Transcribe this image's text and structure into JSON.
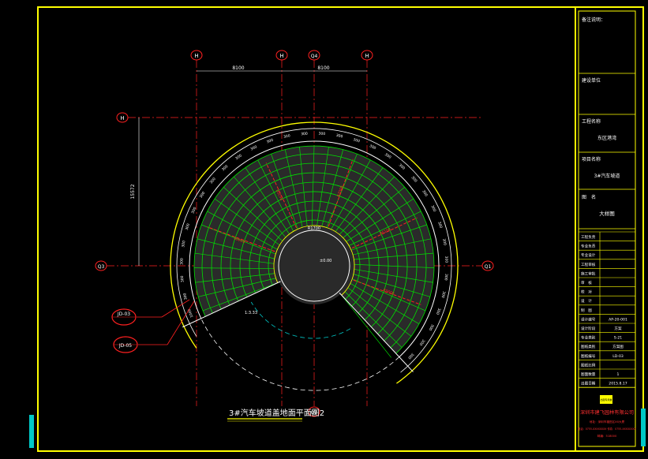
{
  "colors": {
    "frame": "#ffff00",
    "grid_line": "#ff2020",
    "tile": "#00e000",
    "dim": "#ffffff",
    "callout": "#ff2020",
    "cyan": "#00c8c8",
    "company": "#ff3030"
  },
  "drawing": {
    "title": "3#汽车坡道盖地面平面图2",
    "axis_top": [
      "H",
      "H",
      "Q4",
      "H"
    ],
    "axis_left": "H",
    "axis_q3": "Q3",
    "axis_q1": "Q1",
    "axis_q2": "Q2",
    "dim_top_left": "8100",
    "dim_top_right": "8100",
    "dim_vertical": "15572",
    "center_label": "R1700",
    "center_elev": "±0.00",
    "callout_1": "JD-03",
    "callout_2": "JD-05",
    "slope_label": "1:3.33",
    "ring_dims": [
      "1000",
      "300",
      "300",
      "300",
      "300",
      "300",
      "300",
      "300",
      "300",
      "300",
      "300",
      "300",
      "300",
      "300",
      "300",
      "300",
      "300",
      "300",
      "300",
      "300",
      "300",
      "300",
      "300",
      "300",
      "300",
      "300",
      "300",
      "300",
      "300",
      "300",
      "300",
      "300",
      "300"
    ],
    "radial_labels": [
      "R3400",
      "R6300",
      "R7000",
      "R6100",
      "R5600"
    ]
  },
  "title_block": {
    "header": "备注说明：",
    "client_label": "建设单位",
    "project_label": "工程名称",
    "project_value": "东区港湾",
    "item_label": "项目名称",
    "item_value": "3#汽车坡道",
    "drawing_name_label": "图　名",
    "drawing_name_value": "大样图",
    "rows": [
      {
        "label": "工程负责",
        "value": ""
      },
      {
        "label": "专业负责",
        "value": ""
      },
      {
        "label": "专业设计",
        "value": ""
      },
      {
        "label": "工程审核",
        "value": ""
      },
      {
        "label": "施工审批",
        "value": ""
      },
      {
        "label": "审　核",
        "value": ""
      },
      {
        "label": "校　对",
        "value": ""
      },
      {
        "label": "设　计",
        "value": ""
      },
      {
        "label": "制　图",
        "value": ""
      },
      {
        "label": "设计编号",
        "value": "AP-20-001"
      },
      {
        "label": "设计阶段",
        "value": "方案"
      },
      {
        "label": "专业类别",
        "value": "S-21"
      },
      {
        "label": "图纸类别",
        "value": "方案图"
      },
      {
        "label": "图纸编号",
        "value": "LD-03"
      },
      {
        "label": "图纸比例",
        "value": ""
      },
      {
        "label": "图面数量",
        "value": "1"
      },
      {
        "label": "出图日期",
        "value": "2015.8.17"
      }
    ],
    "seal_text": "出图专用章",
    "company": "深圳市建飞园林有限公司",
    "company_line2": "地址：深圳市福田区XX大厦",
    "company_line3": "电话：0755-XXXXXXXX 传真：0755-XXXXXXXX",
    "company_line4": "邮编：518000"
  }
}
